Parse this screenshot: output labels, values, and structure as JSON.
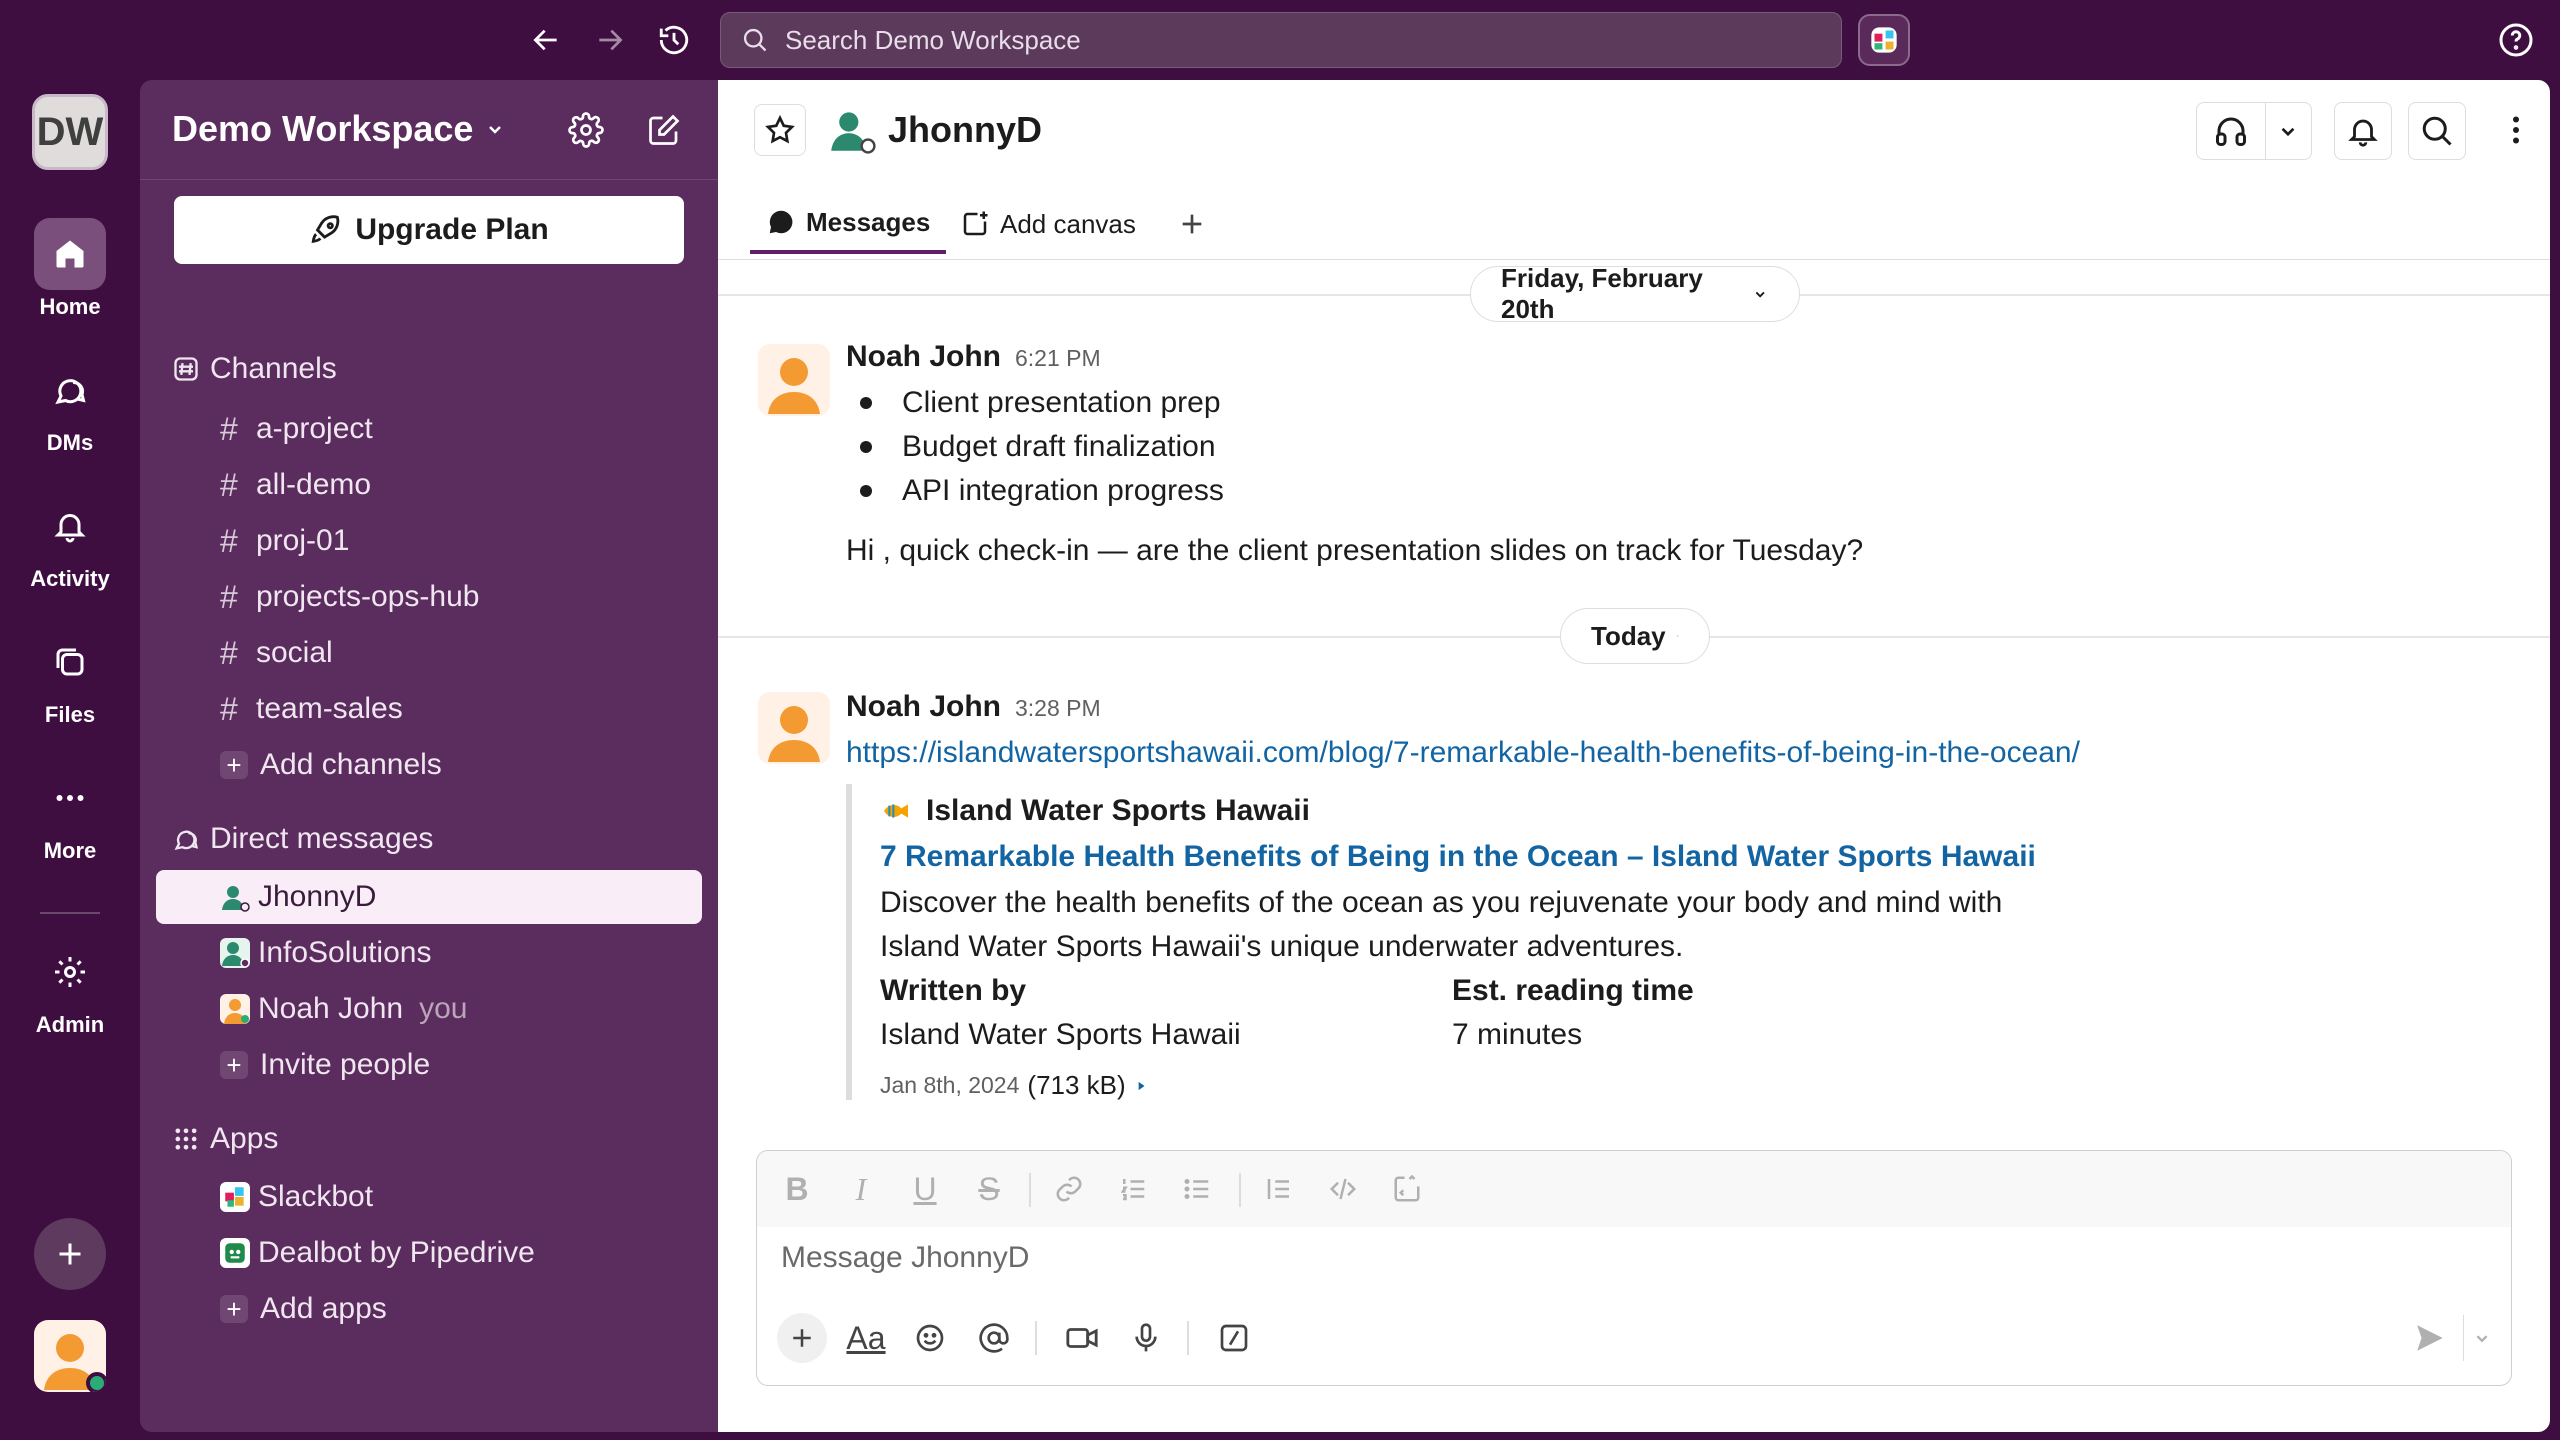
{
  "topbar": {
    "search_placeholder": "Search Demo Workspace"
  },
  "rail": {
    "workspace_initials": "DW",
    "items": [
      {
        "label": "Home",
        "icon": "home-icon"
      },
      {
        "label": "DMs",
        "icon": "dms-icon"
      },
      {
        "label": "Activity",
        "icon": "bell-icon"
      },
      {
        "label": "Files",
        "icon": "files-icon"
      },
      {
        "label": "More",
        "icon": "more-icon"
      },
      {
        "label": "Admin",
        "icon": "gear-icon"
      }
    ]
  },
  "sidebar": {
    "workspace_name": "Demo Workspace",
    "upgrade_label": "Upgrade Plan",
    "channels_header": "Channels",
    "channels": [
      "a-project",
      "all-demo",
      "proj-01",
      "projects-ops-hub",
      "social",
      "team-sales"
    ],
    "add_channels": "Add channels",
    "dm_header": "Direct messages",
    "dms": [
      {
        "name": "JhonnyD",
        "active": true
      },
      {
        "name": "InfoSolutions",
        "active": false
      },
      {
        "name": "Noah John",
        "suffix": "you",
        "active": false
      }
    ],
    "invite_people": "Invite people",
    "apps_header": "Apps",
    "apps": [
      "Slackbot",
      "Dealbot by Pipedrive"
    ],
    "add_apps": "Add apps"
  },
  "channel": {
    "title": "JhonnyD",
    "tabs": {
      "messages": "Messages",
      "add_canvas": "Add canvas"
    }
  },
  "messages": {
    "date1": "Friday, February 20th",
    "m1": {
      "author": "Noah John",
      "time": "6:21 PM",
      "bullets": [
        "Client presentation prep",
        "Budget draft finalization",
        "API integration progress"
      ],
      "text": "Hi , quick check-in — are the client presentation slides on track for Tuesday?"
    },
    "date2": "Today",
    "m2": {
      "author": "Noah John",
      "time": "3:28 PM",
      "link": "https://islandwatersportshawaii.com/blog/7-remarkable-health-benefits-of-being-in-the-ocean/",
      "unfurl": {
        "source": "Island Water Sports Hawaii",
        "title": "7 Remarkable Health Benefits of Being in the Ocean – Island Water Sports Hawaii",
        "desc1": "Discover the health benefits of the ocean as you rejuvenate your body and mind with",
        "desc2": "Island Water Sports Hawaii's unique underwater adventures.",
        "written_by_label": "Written by",
        "written_by": "Island Water Sports Hawaii",
        "reading_label": "Est. reading time",
        "reading": "7 minutes",
        "date": "Jan 8th, 2024",
        "size": "(713 kB)"
      }
    }
  },
  "composer": {
    "placeholder": "Message JhonnyD",
    "aa": "Aa"
  },
  "colors": {
    "aubergine": "#3f0e40",
    "sidebar": "#5b2c5e",
    "link": "#1264a3",
    "online": "#2bac76"
  }
}
